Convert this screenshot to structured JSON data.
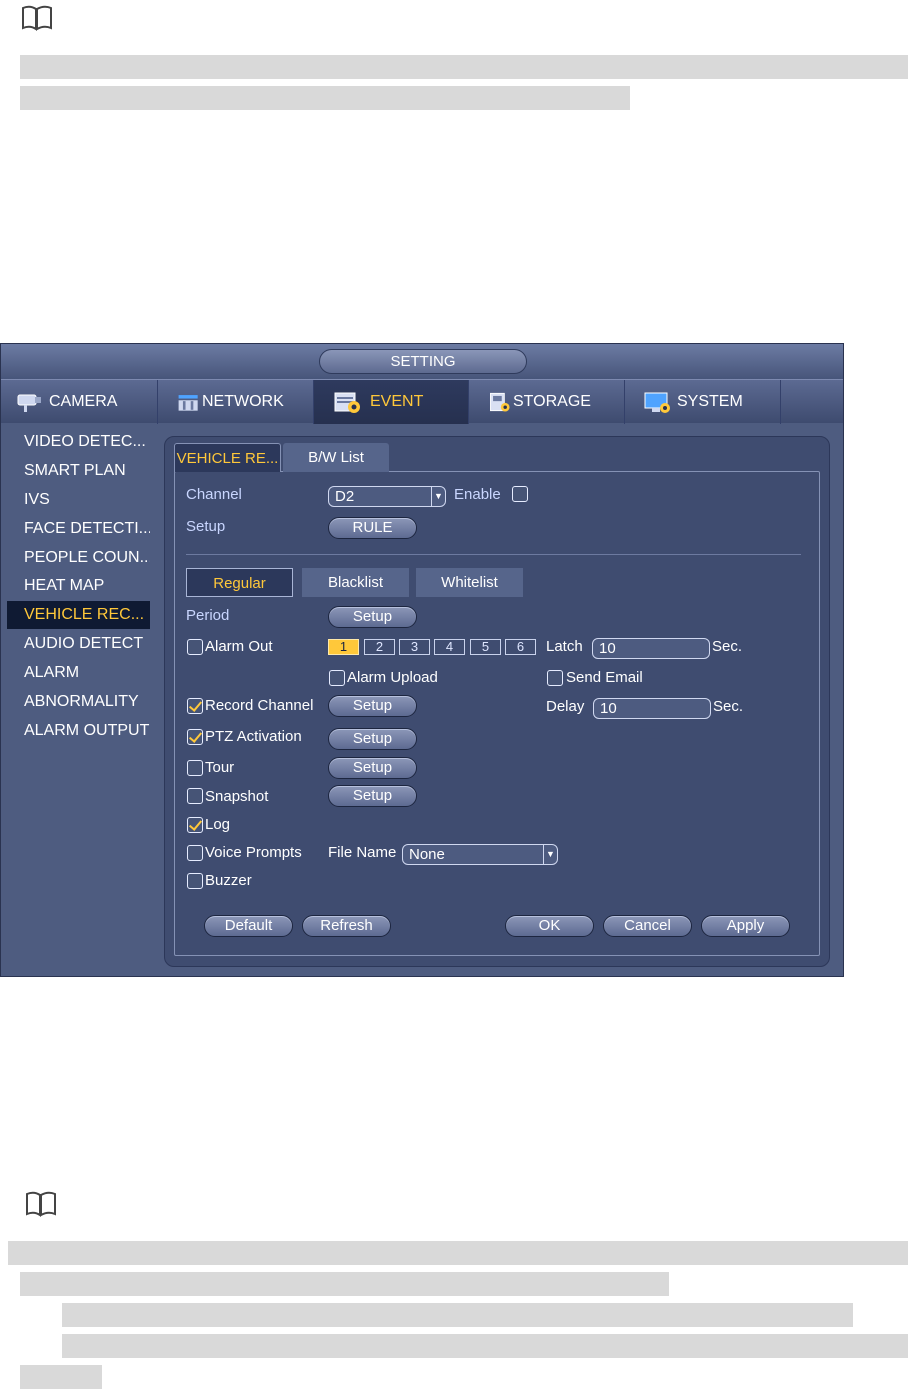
{
  "window": {
    "title": "SETTING"
  },
  "tabs": [
    {
      "label": "CAMERA",
      "icon": "camera-icon"
    },
    {
      "label": "NETWORK",
      "icon": "network-icon"
    },
    {
      "label": "EVENT",
      "icon": "event-icon",
      "active": true
    },
    {
      "label": "STORAGE",
      "icon": "storage-icon"
    },
    {
      "label": "SYSTEM",
      "icon": "system-icon"
    }
  ],
  "sidebar": {
    "items": [
      {
        "label": "VIDEO DETEC..."
      },
      {
        "label": "SMART PLAN"
      },
      {
        "label": "IVS"
      },
      {
        "label": "FACE DETECTI..."
      },
      {
        "label": "PEOPLE COUN..."
      },
      {
        "label": "HEAT MAP"
      },
      {
        "label": "VEHICLE REC...",
        "active": true
      },
      {
        "label": "AUDIO DETECT"
      },
      {
        "label": "ALARM"
      },
      {
        "label": "ABNORMALITY"
      },
      {
        "label": "ALARM OUTPUT"
      }
    ]
  },
  "subtabs": [
    {
      "label": "VEHICLE RE...",
      "active": true
    },
    {
      "label": "B/W List"
    }
  ],
  "form": {
    "channel_label": "Channel",
    "channel_value": "D2",
    "enable_label": "Enable",
    "enable_checked": false,
    "setup_label": "Setup",
    "rule_button": "RULE",
    "category_tabs": [
      {
        "label": "Regular",
        "active": true
      },
      {
        "label": "Blacklist"
      },
      {
        "label": "Whitelist"
      }
    ],
    "period_label": "Period",
    "setup_button": "Setup",
    "alarm_out_label": "Alarm Out",
    "alarm_out_checked": false,
    "alarm_channels": [
      "1",
      "2",
      "3",
      "4",
      "5",
      "6"
    ],
    "alarm_channel_selected": "1",
    "latch_label": "Latch",
    "latch_value": "10",
    "sec_label": "Sec.",
    "alarm_upload_label": "Alarm Upload",
    "alarm_upload_checked": false,
    "send_email_label": "Send Email",
    "send_email_checked": false,
    "record_channel_label": "Record Channel",
    "record_channel_checked": true,
    "delay_label": "Delay",
    "delay_value": "10",
    "ptz_label": "PTZ Activation",
    "ptz_checked": true,
    "tour_label": "Tour",
    "tour_checked": false,
    "snapshot_label": "Snapshot",
    "snapshot_checked": false,
    "log_label": "Log",
    "log_checked": true,
    "voice_prompts_label": "Voice Prompts",
    "voice_prompts_checked": false,
    "file_name_label": "File Name",
    "file_name_value": "None",
    "buzzer_label": "Buzzer",
    "buzzer_checked": false
  },
  "buttons": {
    "default": "Default",
    "refresh": "Refresh",
    "ok": "OK",
    "cancel": "Cancel",
    "apply": "Apply"
  },
  "colors": {
    "accent": "#ffc83a",
    "panel": "#4e5c80",
    "label": "#c9d6ff"
  }
}
